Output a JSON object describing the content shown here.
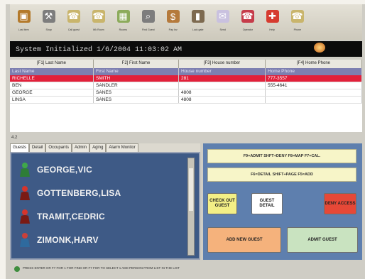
{
  "toolbar": [
    {
      "label": "Lost Item",
      "icon": "briefcase-icon",
      "color": "#b47a2b"
    },
    {
      "label": "Shop",
      "icon": "wrench-icon",
      "color": "#7d7d7d"
    },
    {
      "label": "Call guest",
      "icon": "phone-icon",
      "color": "#c9b56c"
    },
    {
      "label": "Wk Room",
      "icon": "phone-icon",
      "color": "#c9b56c"
    },
    {
      "label": "Rooms",
      "icon": "grid-icon",
      "color": "#8cab5b"
    },
    {
      "label": "Find Guest",
      "icon": "search-icon",
      "color": "#7d7d7d"
    },
    {
      "label": "Pay Inv",
      "icon": "dollar-icon",
      "color": "#b57a3c"
    },
    {
      "label": "Lock gate",
      "icon": "door-icon",
      "color": "#7d6a50"
    },
    {
      "label": "Send",
      "icon": "mail-icon",
      "color": "#c9c1df"
    },
    {
      "label": "Operator",
      "icon": "phone-icon",
      "color": "#c63c4a"
    },
    {
      "label": "Help",
      "icon": "help-icon",
      "color": "#d63b2f"
    },
    {
      "label": "Phone",
      "icon": "phone-icon",
      "color": "#c9b56c"
    }
  ],
  "status": {
    "text": "System Initialized 1/6/2004 11:03:02 AM"
  },
  "search_headers": [
    "[F1] Last Name",
    "F2] First Name",
    "[F3] House number",
    "[F4] Home Phone"
  ],
  "table": {
    "columns": [
      "Last Name",
      "First Name",
      "House number",
      "Home Phone"
    ],
    "rows": [
      {
        "last": "RICHELLE",
        "first": "SMITH",
        "house": "281",
        "phone": "777-3557",
        "selected": true
      },
      {
        "last": "BEN",
        "first": "SANDLER",
        "house": "",
        "phone": "555-4641",
        "selected": false
      },
      {
        "last": "GEORGE",
        "first": "SANES",
        "house": "4808",
        "phone": "",
        "selected": false
      },
      {
        "last": "LINSA",
        "first": "SANES",
        "house": "4808",
        "phone": "",
        "selected": false
      }
    ],
    "count": "4.2"
  },
  "tabs": [
    "Guests",
    "Detail",
    "Occupants",
    "Admin",
    "Aging",
    "Alarm Monitor"
  ],
  "guests": [
    {
      "name": "GEORGE,VIC",
      "icon": "person-green-icon"
    },
    {
      "name": "GOTTENBERG,LISA",
      "icon": "person-red-icon"
    },
    {
      "name": "TRAMIT,CEDRIC",
      "icon": "person-red-icon"
    },
    {
      "name": "ZIMONK,HARV",
      "icon": "person-mixed-icon"
    }
  ],
  "panel": {
    "hint1": "F9=ADMIT  SHFT+DENY  F8=MAP  F7=CAL.",
    "hint2": "F6=DETAIL  SHIFT+PAGE  F5=ADD",
    "buttons": {
      "checkout": "CHECK OUT GUEST",
      "detail": "GUEST DETAIL",
      "deny": "DENY ACCESS",
      "add": "ADD NEW GUEST",
      "admit": "ADMIT GUEST"
    },
    "colors": {
      "checkout": "#f3ef86",
      "detail": "#ffffff",
      "deny": "#e64837",
      "add": "#f5b27c",
      "admit": "#c9e3c0"
    }
  },
  "footer": {
    "text": "PRESS ENTER OR F7 FOR 1 FOR FIND OR F7 FOR TO SELECT 1 ADD PERSON FROM LIST IN THE LIST"
  }
}
